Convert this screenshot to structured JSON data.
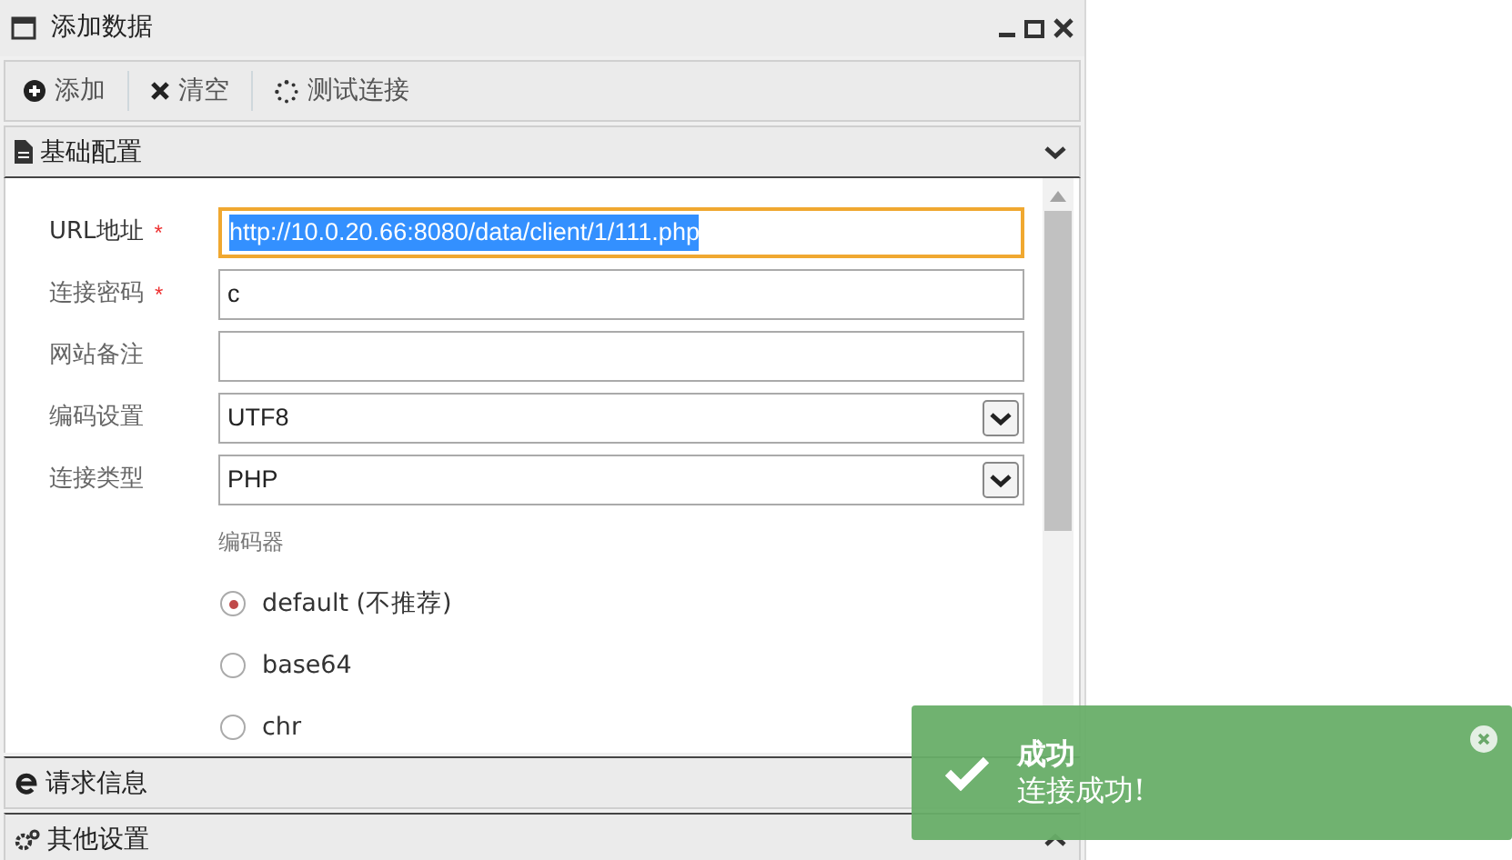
{
  "window": {
    "title": "添加数据"
  },
  "toolbar": [
    {
      "kind": "add",
      "label": "添加"
    },
    {
      "kind": "clear",
      "label": "清空"
    },
    {
      "kind": "test",
      "label": "测试连接"
    }
  ],
  "sections": [
    {
      "kind": "doc",
      "title": "基础配置",
      "expanded": true
    },
    {
      "kind": "ie",
      "title": "请求信息",
      "expanded": false
    },
    {
      "kind": "gears",
      "title": "其他设置",
      "expanded": false
    }
  ],
  "form": {
    "fields": [
      {
        "kind": "text",
        "label": "URL地址",
        "required_mark": "*",
        "value": "http://10.0.20.66:8080/data/client/1/111.php",
        "focused": true
      },
      {
        "kind": "text",
        "label": "连接密码",
        "required_mark": "*",
        "value": "c",
        "focused": false
      },
      {
        "kind": "text",
        "label": "网站备注",
        "focused": false
      },
      {
        "kind": "select",
        "label": "编码设置",
        "value": "UTF8",
        "focused": false
      },
      {
        "kind": "select",
        "label": "连接类型",
        "value": "PHP",
        "focused": false
      }
    ],
    "encoder": {
      "label": "编码器",
      "options": [
        {
          "label": "default (不推荐)",
          "selected": true
        },
        {
          "label": "base64",
          "selected": false
        },
        {
          "label": "chr",
          "selected": false
        }
      ]
    }
  },
  "toast": {
    "title": "成功",
    "message": "连接成功!"
  }
}
